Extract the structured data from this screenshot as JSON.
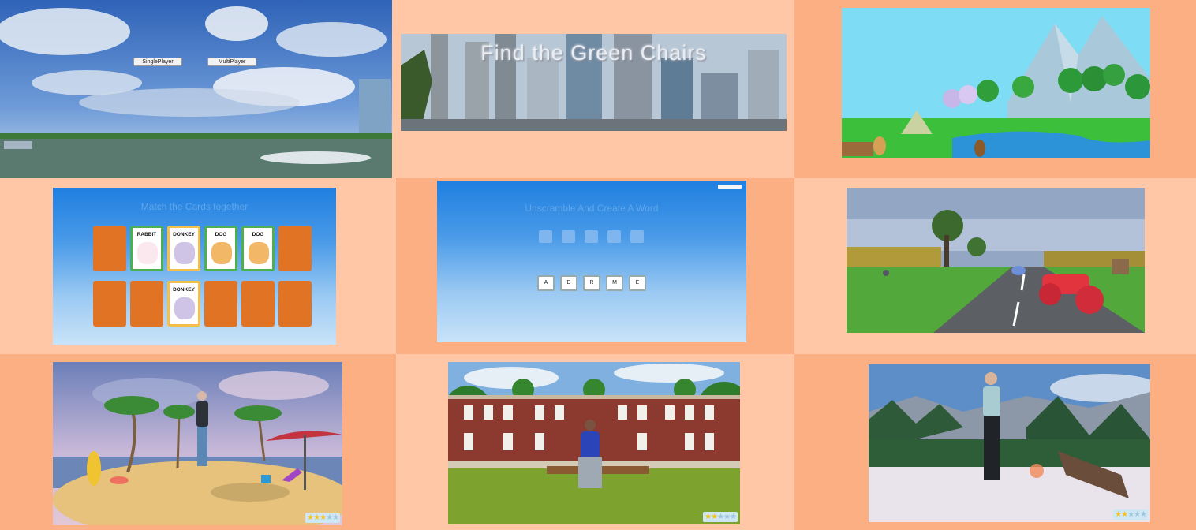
{
  "panels": {
    "menu": {
      "single_label": "SinglePlayer",
      "multi_label": "MultiPlayer"
    },
    "city": {
      "title": "Find the Green Chairs"
    },
    "memory": {
      "title": "Match the Cards together",
      "cards": [
        {
          "label": "RABBIT",
          "animal": "rabbit"
        },
        {
          "label": "DONKEY",
          "animal": "donkey"
        },
        {
          "label": "DOG",
          "animal": "dog"
        },
        {
          "label": "DOG",
          "animal": "dog"
        },
        {
          "label": "DONKEY",
          "animal": "donkey"
        }
      ]
    },
    "scramble": {
      "title": "Unscramble And Create A Word",
      "letters": [
        "A",
        "D",
        "R",
        "M",
        "E"
      ]
    },
    "ratings": {
      "beach": 3,
      "courtyard": 2,
      "snow": 2,
      "max": 5
    }
  },
  "colors": {
    "bg_light": "#ffc7a6",
    "bg_dark": "#fdaf84",
    "card_back": "#e07424",
    "player_icon": "#22c33a",
    "star_on": "#f4c21d"
  },
  "icons": [
    "player-icon",
    "star-icon"
  ]
}
